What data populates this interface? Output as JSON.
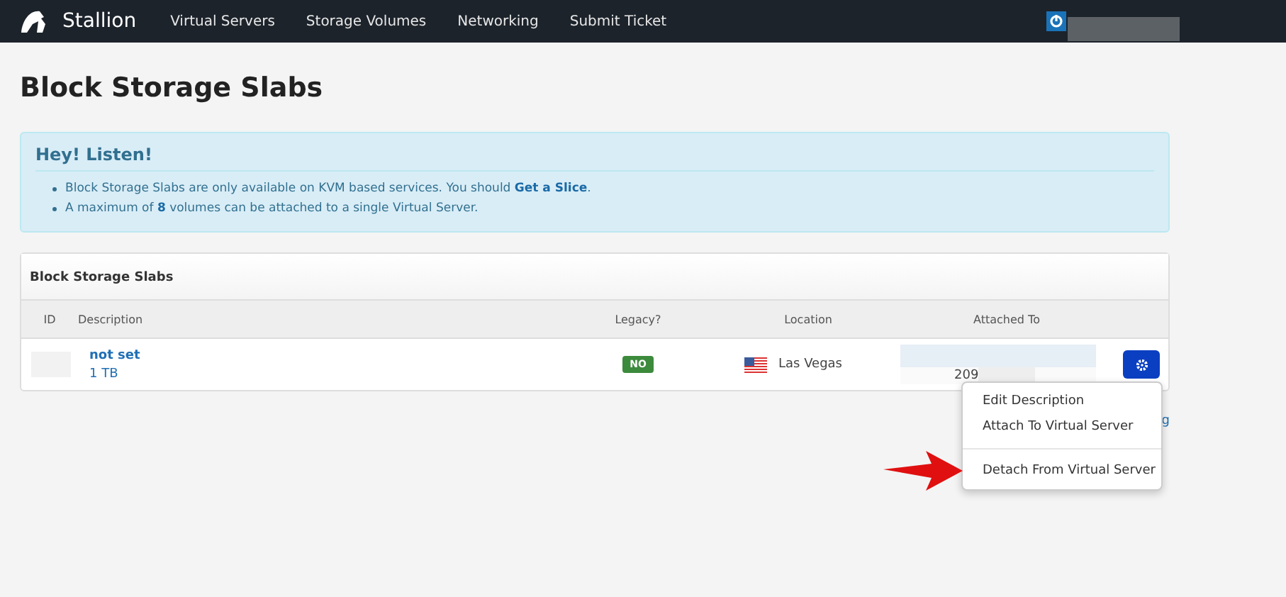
{
  "navbar": {
    "brand": "Stallion",
    "links": [
      "Virtual Servers",
      "Storage Volumes",
      "Networking",
      "Submit Ticket"
    ]
  },
  "page_title": "Block Storage Slabs",
  "alert": {
    "title": "Hey! Listen!",
    "items": [
      "Block Storage Slabs are only available on KVM based services. You should **Get a Slice**.",
      "A maximum of **8** volumes can be attached to a single Virtual Server."
    ]
  },
  "panel": {
    "title": "Block Storage Slabs",
    "columns": [
      "ID",
      "Description",
      "Legacy?",
      "Location",
      "Attached To"
    ],
    "rows": [
      {
        "description": "not set",
        "size": "1 TB",
        "legacy": "NO",
        "location": "Las Vegas",
        "attached_to": "209"
      }
    ]
  },
  "partial_link": "g",
  "menu": {
    "items": [
      {
        "label": "Edit Description",
        "divider_before": false
      },
      {
        "label": "Attach To Virtual Server",
        "divider_before": false
      },
      {
        "label": "Detach From Virtual Server",
        "divider_before": true
      }
    ]
  }
}
